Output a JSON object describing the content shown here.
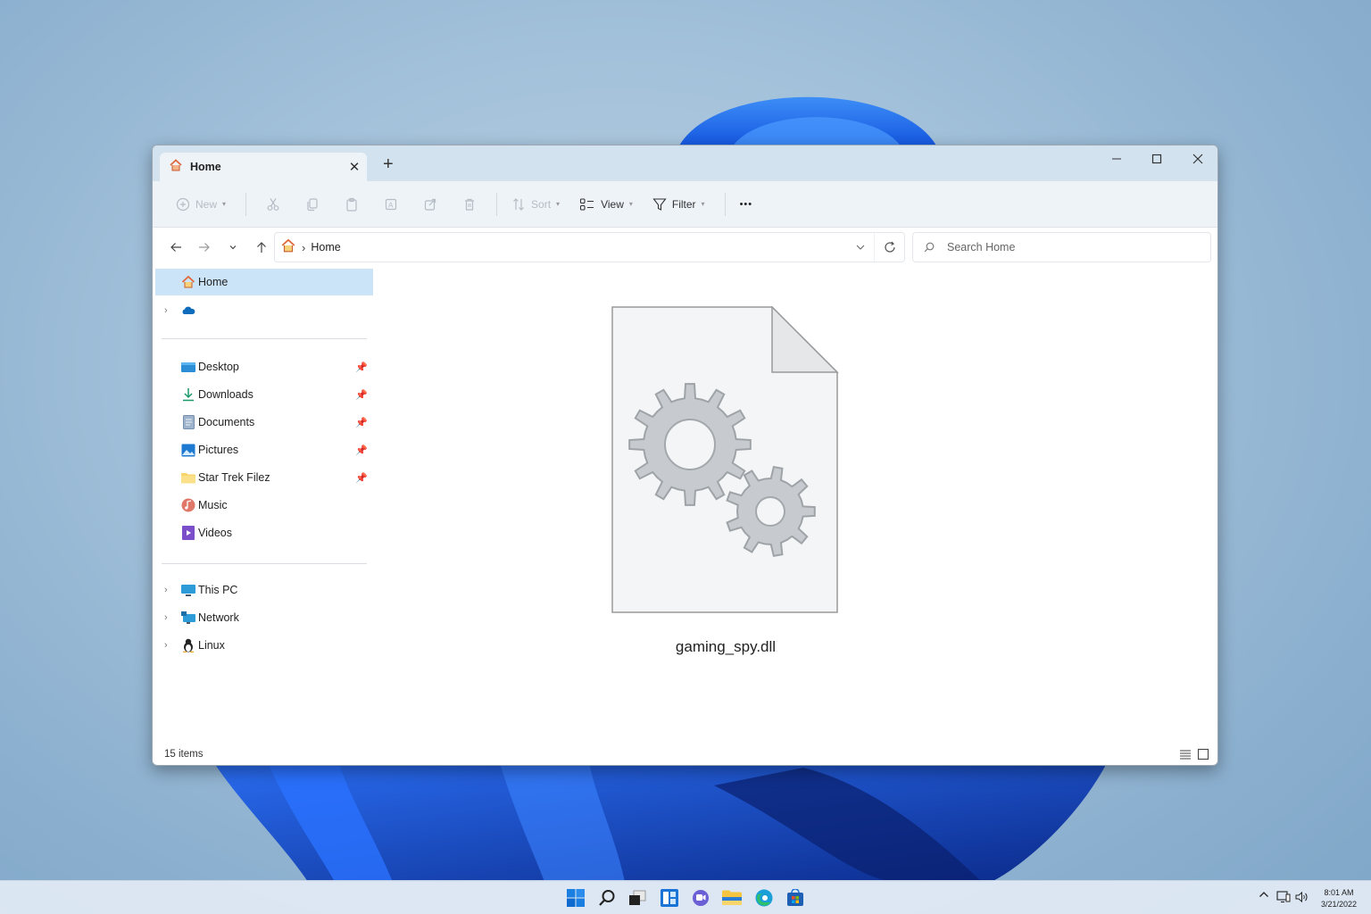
{
  "window": {
    "tab_title": "Home",
    "tab_icon": "home-icon",
    "controls": {
      "minimize": "minimize-icon",
      "maximize": "maximize-icon",
      "close": "close-icon"
    }
  },
  "toolbar": {
    "new_label": "New",
    "sort_label": "Sort",
    "view_label": "View",
    "filter_label": "Filter",
    "more_label": "•••",
    "icons": [
      "cut-icon",
      "copy-icon",
      "paste-icon",
      "rename-icon",
      "share-icon",
      "delete-icon"
    ]
  },
  "address": {
    "breadcrumb": "Home",
    "separator": "›"
  },
  "search": {
    "placeholder": "Search Home",
    "value": ""
  },
  "sidebar": {
    "top": [
      {
        "label": "Home",
        "icon": "home-icon",
        "selected": true
      },
      {
        "label": "",
        "icon": "onedrive-icon",
        "expandable": true
      }
    ],
    "pinned": [
      {
        "label": "Desktop",
        "icon": "desktop-icon",
        "pinned": true
      },
      {
        "label": "Downloads",
        "icon": "downloads-icon",
        "pinned": true
      },
      {
        "label": "Documents",
        "icon": "documents-icon",
        "pinned": true
      },
      {
        "label": "Pictures",
        "icon": "pictures-icon",
        "pinned": true
      },
      {
        "label": "Star Trek Filez",
        "icon": "folder-icon",
        "pinned": true
      },
      {
        "label": "Music",
        "icon": "music-icon",
        "pinned": false
      },
      {
        "label": "Videos",
        "icon": "videos-icon",
        "pinned": false
      }
    ],
    "locations": [
      {
        "label": "This PC",
        "icon": "this-pc-icon",
        "expandable": true
      },
      {
        "label": "Network",
        "icon": "network-icon",
        "expandable": true
      },
      {
        "label": "Linux",
        "icon": "linux-icon",
        "expandable": true
      }
    ]
  },
  "content": {
    "file": {
      "name": "gaming_spy.dll",
      "icon": "dll-file-icon"
    }
  },
  "status": {
    "item_count": "15 items"
  },
  "taskbar": {
    "apps": [
      "start-icon",
      "search-icon",
      "task-view-icon",
      "widgets-icon",
      "teams-chat-icon",
      "file-explorer-icon",
      "edge-icon",
      "store-icon"
    ],
    "tray": [
      "chevron-up-icon",
      "network-icon",
      "volume-icon"
    ],
    "time": "8:01 AM",
    "date": "3/21/2022"
  },
  "colors": {
    "accent": "#0067c0",
    "selection": "#cce4f7",
    "titlebar": "#d3e2ef",
    "toolbar": "#eef3f8"
  }
}
